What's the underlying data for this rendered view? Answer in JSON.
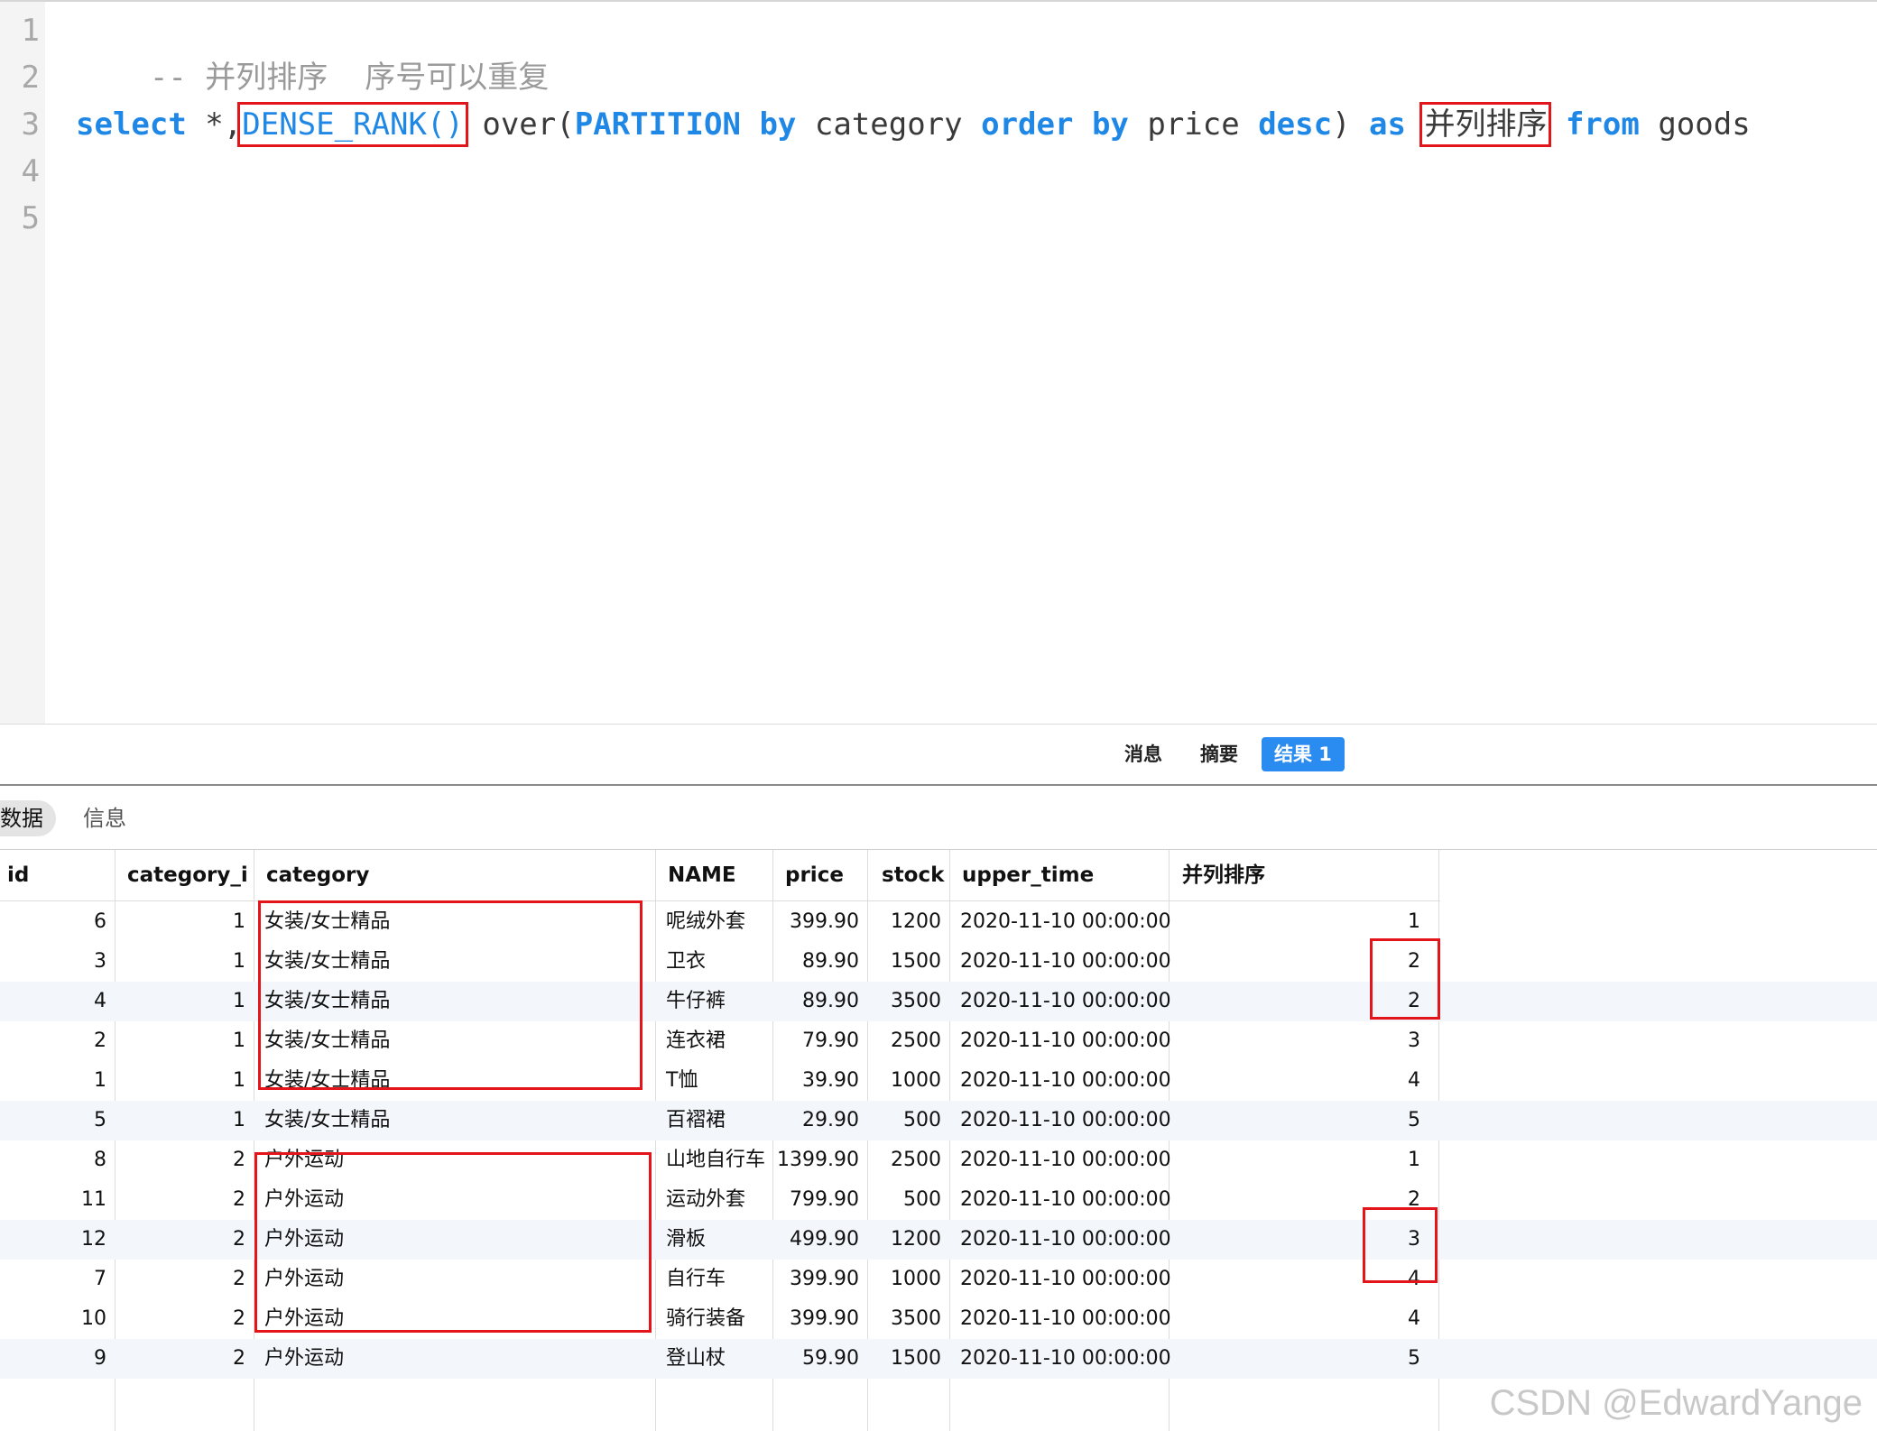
{
  "editor": {
    "line_numbers": [
      "1",
      "2",
      "3",
      "4",
      "5"
    ],
    "comment": "-- 并列排序  序号可以重复",
    "sql": {
      "select": "select",
      "star": " *,",
      "func": "DENSE_RANK()",
      "over": " over(",
      "partition": "PARTITION",
      "by1": "by",
      "category": " category ",
      "order": "order",
      "by2": "by",
      "price": " price ",
      "desc": "desc",
      "close": ") ",
      "as": "as",
      "alias": "并列排序",
      "from": "from",
      "goods": " goods"
    }
  },
  "result_tabs": [
    "消息",
    "摘要",
    "结果 1"
  ],
  "active_result_tab": "结果 1",
  "sub_tabs": [
    "数据",
    "信息"
  ],
  "active_sub_tab": "数据",
  "grid": {
    "columns": [
      "id",
      "category_i",
      "category",
      "NAME",
      "price",
      "stock",
      "upper_time",
      "并列排序"
    ],
    "rows": [
      {
        "id": "6",
        "category_id": "1",
        "category": "女装/女士精品",
        "name": "呢绒外套",
        "price": "399.90",
        "stock": "1200",
        "upper_time": "2020-11-10 00:00:00",
        "rank": "1"
      },
      {
        "id": "3",
        "category_id": "1",
        "category": "女装/女士精品",
        "name": "卫衣",
        "price": "89.90",
        "stock": "1500",
        "upper_time": "2020-11-10 00:00:00",
        "rank": "2"
      },
      {
        "id": "4",
        "category_id": "1",
        "category": "女装/女士精品",
        "name": "牛仔裤",
        "price": "89.90",
        "stock": "3500",
        "upper_time": "2020-11-10 00:00:00",
        "rank": "2"
      },
      {
        "id": "2",
        "category_id": "1",
        "category": "女装/女士精品",
        "name": "连衣裙",
        "price": "79.90",
        "stock": "2500",
        "upper_time": "2020-11-10 00:00:00",
        "rank": "3"
      },
      {
        "id": "1",
        "category_id": "1",
        "category": "女装/女士精品",
        "name": "T恤",
        "price": "39.90",
        "stock": "1000",
        "upper_time": "2020-11-10 00:00:00",
        "rank": "4"
      },
      {
        "id": "5",
        "category_id": "1",
        "category": "女装/女士精品",
        "name": "百褶裙",
        "price": "29.90",
        "stock": "500",
        "upper_time": "2020-11-10 00:00:00",
        "rank": "5"
      },
      {
        "id": "8",
        "category_id": "2",
        "category": "户外运动",
        "name": "山地自行车",
        "price": "1399.90",
        "stock": "2500",
        "upper_time": "2020-11-10 00:00:00",
        "rank": "1"
      },
      {
        "id": "11",
        "category_id": "2",
        "category": "户外运动",
        "name": "运动外套",
        "price": "799.90",
        "stock": "500",
        "upper_time": "2020-11-10 00:00:00",
        "rank": "2"
      },
      {
        "id": "12",
        "category_id": "2",
        "category": "户外运动",
        "name": "滑板",
        "price": "499.90",
        "stock": "1200",
        "upper_time": "2020-11-10 00:00:00",
        "rank": "3"
      },
      {
        "id": "7",
        "category_id": "2",
        "category": "户外运动",
        "name": "自行车",
        "price": "399.90",
        "stock": "1000",
        "upper_time": "2020-11-10 00:00:00",
        "rank": "4"
      },
      {
        "id": "10",
        "category_id": "2",
        "category": "户外运动",
        "name": "骑行装备",
        "price": "399.90",
        "stock": "3500",
        "upper_time": "2020-11-10 00:00:00",
        "rank": "4"
      },
      {
        "id": "9",
        "category_id": "2",
        "category": "户外运动",
        "name": "登山杖",
        "price": "59.90",
        "stock": "1500",
        "upper_time": "2020-11-10 00:00:00",
        "rank": "5"
      }
    ]
  },
  "colors": {
    "keyword": "#1f87e5",
    "highlight_box": "#e4141b",
    "active_tab": "#2a8cf0"
  },
  "watermark": "CSDN @EdwardYange"
}
